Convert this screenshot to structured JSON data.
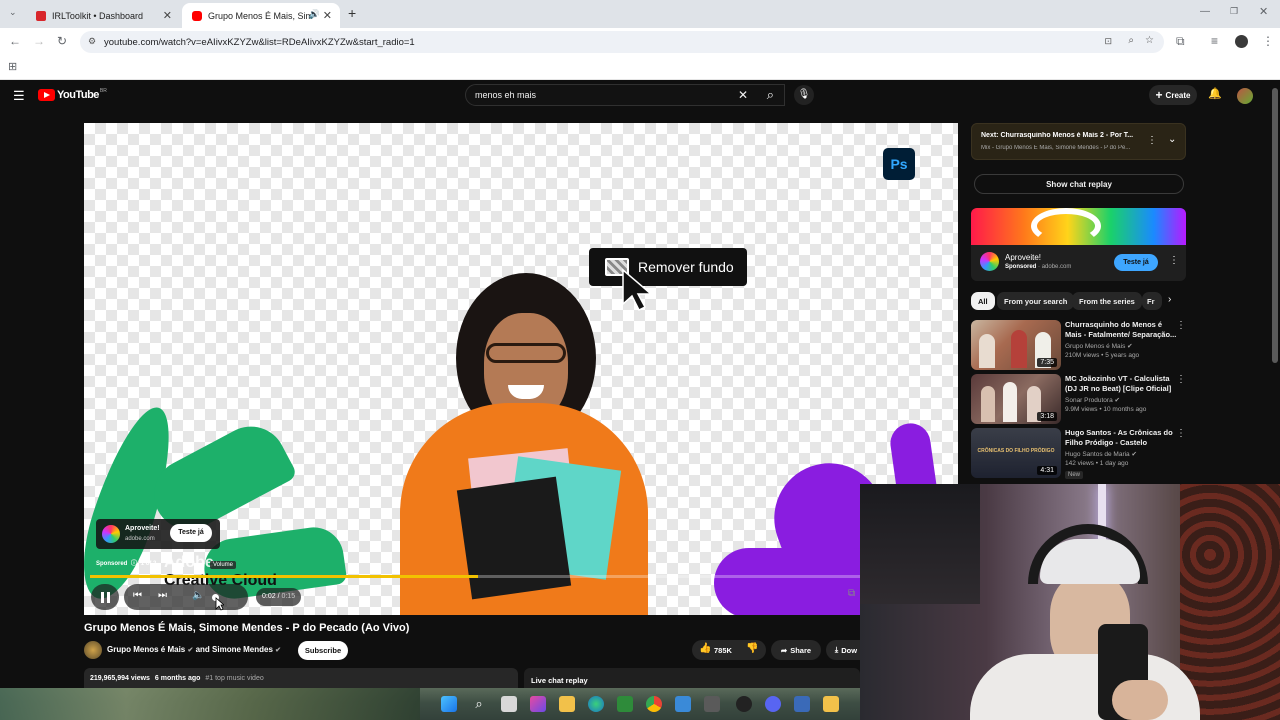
{
  "browser": {
    "tabs": [
      {
        "title": "IRLToolkit • Dashboard",
        "active": false
      },
      {
        "title": "Grupo Menos É Mais, Simon",
        "active": true
      }
    ],
    "url": "youtube.com/watch?v=eAIivxKZYZw&list=RDeAIivxKZYZw&start_radio=1"
  },
  "youtube": {
    "logo_text": "YouTube",
    "logo_region": "BR",
    "search_value": "menos eh mais",
    "create_label": "Create",
    "player": {
      "ad_overlay_text": "Remover fundo",
      "ps_badge": "Ps",
      "ad_card_title": "Aproveite!",
      "ad_card_domain": "adobe.com",
      "ad_card_button": "Teste já",
      "sponsored_label": "Sponsored",
      "ad_position": "1 of 2",
      "brand_line1": "Adobe",
      "brand_line2": "Creative Cloud",
      "volume_tooltip": "Volume",
      "time_current": "0:02",
      "time_total": "0:15",
      "progress": 0.45
    },
    "video": {
      "title": "Grupo Menos É Mais, Simone Mendes - P do Pecado (Ao Vivo)",
      "channel": "Grupo Menos é Mais",
      "and_channel": "and Simone Mendes",
      "subscribe_label": "Subscribe",
      "likes": "785K",
      "share_label": "Share",
      "download_label": "Dow",
      "views": "219,965,994 views",
      "age": "6 months ago",
      "tag": "#1 top music video",
      "live_chat_label": "Live chat replay"
    },
    "sidebar": {
      "next_title": "Next: Churrasquinho Menos é Mais 2 - Por T...",
      "next_sub": "Mix - Grupo Menos É Mais, Simone Mendes - P do Pe...",
      "show_chat_label": "Show chat replay",
      "ad_title": "Aproveite!",
      "ad_sponsored": "Sponsored",
      "ad_domain": "adobe.com",
      "ad_button": "Teste já",
      "chips": [
        "All",
        "From your search",
        "From the series",
        "Fr"
      ],
      "items": [
        {
          "title": "Churrasquinho do Menos é Mais - Fatalmente/ Separação...",
          "channel": "Grupo Menos é Mais",
          "meta": "210M views • 5 years ago",
          "duration": "7:35"
        },
        {
          "title": "MC Joãozinho VT - Calculista (DJ JR no Beat) [Clipe Oficial]",
          "channel": "Sonar Produtora",
          "meta": "9.9M views • 10 months ago",
          "duration": "3:18"
        },
        {
          "title": "Hugo Santos - As Crônicas do Filho Pródigo - Castelo",
          "channel": "Hugo Santos de Maria",
          "meta": "142 views • 1 day ago",
          "duration": "4:31",
          "badge": "New",
          "thumb_text": "CRÔNICAS DO FILHO PRÓDIGO"
        }
      ]
    }
  },
  "colors": {
    "yt_red": "#ff0000",
    "yt_bg": "#0f0f0f",
    "accent_blue": "#3ea6ff",
    "adobe_green": "#1db06a",
    "adobe_purple": "#8a1de0",
    "hoodie_orange": "#f07a1a"
  }
}
